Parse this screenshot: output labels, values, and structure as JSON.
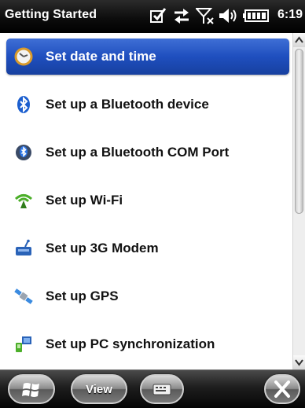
{
  "status_bar": {
    "title": "Getting Started",
    "time": "6:19",
    "icons": [
      "notification-icon",
      "sync-icon",
      "signal-off-icon",
      "volume-icon",
      "battery-icon"
    ]
  },
  "list": {
    "items": [
      {
        "label": "Set date and time",
        "icon": "clock-icon",
        "selected": true
      },
      {
        "label": "Set up a Bluetooth device",
        "icon": "bluetooth-icon",
        "selected": false
      },
      {
        "label": "Set up a Bluetooth COM Port",
        "icon": "bluetooth-com-icon",
        "selected": false
      },
      {
        "label": "Set up Wi-Fi",
        "icon": "wifi-icon",
        "selected": false
      },
      {
        "label": "Set up 3G Modem",
        "icon": "modem-icon",
        "selected": false
      },
      {
        "label": "Set up GPS",
        "icon": "gps-satellite-icon",
        "selected": false
      },
      {
        "label": "Set up PC synchronization",
        "icon": "pc-sync-icon",
        "selected": false
      }
    ]
  },
  "softkeys": {
    "start_icon": "windows-start-icon",
    "view_label": "View",
    "keyboard_icon": "keyboard-icon",
    "close_icon": "close-icon"
  },
  "colors": {
    "selection": "#2a57c8",
    "status_bar": "#000000",
    "text": "#111111"
  }
}
